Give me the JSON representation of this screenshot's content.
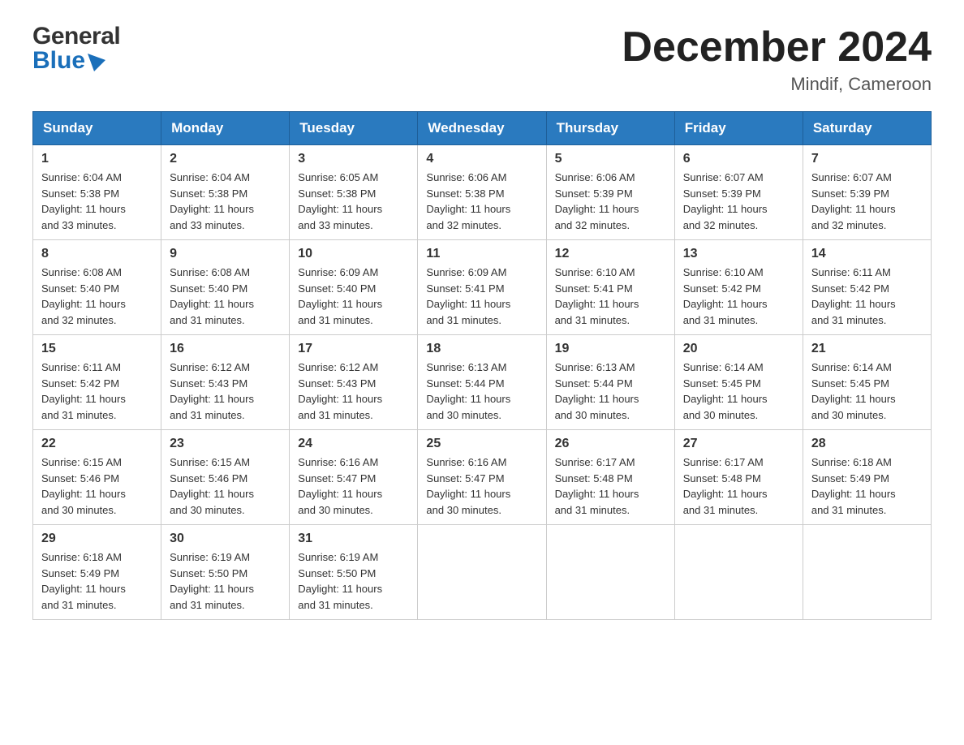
{
  "logo": {
    "general": "General",
    "blue": "Blue"
  },
  "title": "December 2024",
  "location": "Mindif, Cameroon",
  "weekdays": [
    "Sunday",
    "Monday",
    "Tuesday",
    "Wednesday",
    "Thursday",
    "Friday",
    "Saturday"
  ],
  "weeks": [
    [
      {
        "day": "1",
        "sunrise": "6:04 AM",
        "sunset": "5:38 PM",
        "daylight": "11 hours and 33 minutes."
      },
      {
        "day": "2",
        "sunrise": "6:04 AM",
        "sunset": "5:38 PM",
        "daylight": "11 hours and 33 minutes."
      },
      {
        "day": "3",
        "sunrise": "6:05 AM",
        "sunset": "5:38 PM",
        "daylight": "11 hours and 33 minutes."
      },
      {
        "day": "4",
        "sunrise": "6:06 AM",
        "sunset": "5:38 PM",
        "daylight": "11 hours and 32 minutes."
      },
      {
        "day": "5",
        "sunrise": "6:06 AM",
        "sunset": "5:39 PM",
        "daylight": "11 hours and 32 minutes."
      },
      {
        "day": "6",
        "sunrise": "6:07 AM",
        "sunset": "5:39 PM",
        "daylight": "11 hours and 32 minutes."
      },
      {
        "day": "7",
        "sunrise": "6:07 AM",
        "sunset": "5:39 PM",
        "daylight": "11 hours and 32 minutes."
      }
    ],
    [
      {
        "day": "8",
        "sunrise": "6:08 AM",
        "sunset": "5:40 PM",
        "daylight": "11 hours and 32 minutes."
      },
      {
        "day": "9",
        "sunrise": "6:08 AM",
        "sunset": "5:40 PM",
        "daylight": "11 hours and 31 minutes."
      },
      {
        "day": "10",
        "sunrise": "6:09 AM",
        "sunset": "5:40 PM",
        "daylight": "11 hours and 31 minutes."
      },
      {
        "day": "11",
        "sunrise": "6:09 AM",
        "sunset": "5:41 PM",
        "daylight": "11 hours and 31 minutes."
      },
      {
        "day": "12",
        "sunrise": "6:10 AM",
        "sunset": "5:41 PM",
        "daylight": "11 hours and 31 minutes."
      },
      {
        "day": "13",
        "sunrise": "6:10 AM",
        "sunset": "5:42 PM",
        "daylight": "11 hours and 31 minutes."
      },
      {
        "day": "14",
        "sunrise": "6:11 AM",
        "sunset": "5:42 PM",
        "daylight": "11 hours and 31 minutes."
      }
    ],
    [
      {
        "day": "15",
        "sunrise": "6:11 AM",
        "sunset": "5:42 PM",
        "daylight": "11 hours and 31 minutes."
      },
      {
        "day": "16",
        "sunrise": "6:12 AM",
        "sunset": "5:43 PM",
        "daylight": "11 hours and 31 minutes."
      },
      {
        "day": "17",
        "sunrise": "6:12 AM",
        "sunset": "5:43 PM",
        "daylight": "11 hours and 31 minutes."
      },
      {
        "day": "18",
        "sunrise": "6:13 AM",
        "sunset": "5:44 PM",
        "daylight": "11 hours and 30 minutes."
      },
      {
        "day": "19",
        "sunrise": "6:13 AM",
        "sunset": "5:44 PM",
        "daylight": "11 hours and 30 minutes."
      },
      {
        "day": "20",
        "sunrise": "6:14 AM",
        "sunset": "5:45 PM",
        "daylight": "11 hours and 30 minutes."
      },
      {
        "day": "21",
        "sunrise": "6:14 AM",
        "sunset": "5:45 PM",
        "daylight": "11 hours and 30 minutes."
      }
    ],
    [
      {
        "day": "22",
        "sunrise": "6:15 AM",
        "sunset": "5:46 PM",
        "daylight": "11 hours and 30 minutes."
      },
      {
        "day": "23",
        "sunrise": "6:15 AM",
        "sunset": "5:46 PM",
        "daylight": "11 hours and 30 minutes."
      },
      {
        "day": "24",
        "sunrise": "6:16 AM",
        "sunset": "5:47 PM",
        "daylight": "11 hours and 30 minutes."
      },
      {
        "day": "25",
        "sunrise": "6:16 AM",
        "sunset": "5:47 PM",
        "daylight": "11 hours and 30 minutes."
      },
      {
        "day": "26",
        "sunrise": "6:17 AM",
        "sunset": "5:48 PM",
        "daylight": "11 hours and 31 minutes."
      },
      {
        "day": "27",
        "sunrise": "6:17 AM",
        "sunset": "5:48 PM",
        "daylight": "11 hours and 31 minutes."
      },
      {
        "day": "28",
        "sunrise": "6:18 AM",
        "sunset": "5:49 PM",
        "daylight": "11 hours and 31 minutes."
      }
    ],
    [
      {
        "day": "29",
        "sunrise": "6:18 AM",
        "sunset": "5:49 PM",
        "daylight": "11 hours and 31 minutes."
      },
      {
        "day": "30",
        "sunrise": "6:19 AM",
        "sunset": "5:50 PM",
        "daylight": "11 hours and 31 minutes."
      },
      {
        "day": "31",
        "sunrise": "6:19 AM",
        "sunset": "5:50 PM",
        "daylight": "11 hours and 31 minutes."
      },
      null,
      null,
      null,
      null
    ]
  ],
  "labels": {
    "sunrise": "Sunrise:",
    "sunset": "Sunset:",
    "daylight": "Daylight:"
  }
}
